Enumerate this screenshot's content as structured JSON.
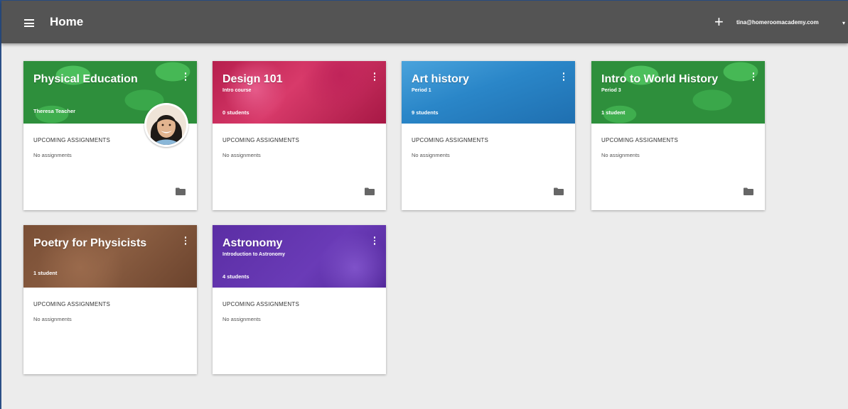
{
  "header": {
    "title": "Home",
    "account_email": "tina@homeroomacademy.com"
  },
  "courses": [
    {
      "title": "Physical Education",
      "subtitle": "",
      "meta": "Theresa Teacher",
      "upcoming_label": "UPCOMING ASSIGNMENTS",
      "assignments_text": "No assignments",
      "color": "#2e8f3c"
    },
    {
      "title": "Design 101",
      "subtitle": "Intro course",
      "meta": "0 students",
      "upcoming_label": "UPCOMING ASSIGNMENTS",
      "assignments_text": "No assignments",
      "color": "#b61e4d"
    },
    {
      "title": "Art history",
      "subtitle": "Period 1",
      "meta": "9 students",
      "upcoming_label": "UPCOMING ASSIGNMENTS",
      "assignments_text": "No assignments",
      "color": "#2a86c8"
    },
    {
      "title": "Intro to World History",
      "subtitle": "Period 3",
      "meta": "1 student",
      "upcoming_label": "UPCOMING ASSIGNMENTS",
      "assignments_text": "No assignments",
      "color": "#2e8f3c"
    },
    {
      "title": "Poetry for Physicists",
      "subtitle": "",
      "meta": "1 student",
      "upcoming_label": "UPCOMING ASSIGNMENTS",
      "assignments_text": "No assignments",
      "color": "#7a4f36"
    },
    {
      "title": "Astronomy",
      "subtitle": "Introduction to Astronomy",
      "meta": "4 students",
      "upcoming_label": "UPCOMING ASSIGNMENTS",
      "assignments_text": "No assignments",
      "color": "#5b2ea4"
    }
  ],
  "icons": {
    "menu": "menu-icon",
    "add": "plus-icon",
    "account_caret": "caret-down-icon",
    "card_menu": "more-vert-icon",
    "folder": "folder-icon",
    "avatar": "teacher-avatar"
  }
}
